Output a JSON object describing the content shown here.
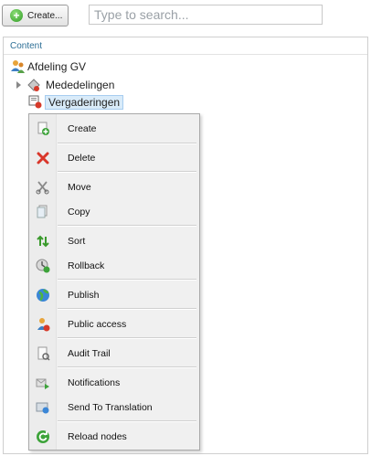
{
  "toolbar": {
    "create_label": "Create...",
    "search_placeholder": "Type to search..."
  },
  "panel": {
    "header": "Content"
  },
  "tree": {
    "root": "Afdeling GV",
    "children": [
      "Mededelingen",
      "Vergaderingen"
    ],
    "selected": "Vergaderingen"
  },
  "context_menu": {
    "items": [
      {
        "label": "Create",
        "icon": "create-icon"
      },
      {
        "label": "Delete",
        "icon": "delete-icon"
      },
      {
        "label": "Move",
        "icon": "move-icon"
      },
      {
        "label": "Copy",
        "icon": "copy-icon"
      },
      {
        "label": "Sort",
        "icon": "sort-icon"
      },
      {
        "label": "Rollback",
        "icon": "rollback-icon"
      },
      {
        "label": "Publish",
        "icon": "publish-icon"
      },
      {
        "label": "Public access",
        "icon": "public-access-icon"
      },
      {
        "label": "Audit Trail",
        "icon": "audit-trail-icon"
      },
      {
        "label": "Notifications",
        "icon": "notifications-icon"
      },
      {
        "label": "Send To Translation",
        "icon": "send-to-translation-icon"
      },
      {
        "label": "Reload nodes",
        "icon": "reload-nodes-icon"
      }
    ]
  }
}
